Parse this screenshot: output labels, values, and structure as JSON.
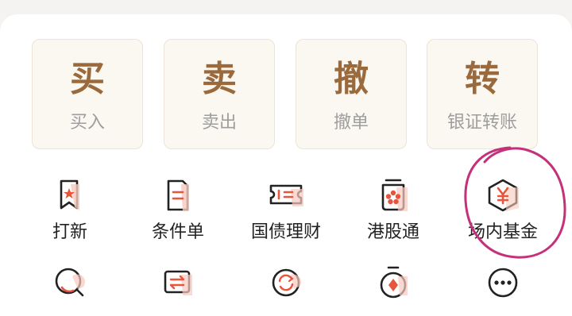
{
  "trade_tiles": [
    {
      "glyph": "买",
      "label": "买入"
    },
    {
      "glyph": "卖",
      "label": "卖出"
    },
    {
      "glyph": "撤",
      "label": "撤单"
    },
    {
      "glyph": "转",
      "label": "银证转账"
    }
  ],
  "feature_row_1": [
    {
      "label": "打新",
      "icon": "bookmark-star-icon"
    },
    {
      "label": "条件单",
      "icon": "conditional-order-icon"
    },
    {
      "label": "国债理财",
      "icon": "bond-ticket-icon"
    },
    {
      "label": "港股通",
      "icon": "hk-stock-connect-icon"
    },
    {
      "label": "场内基金",
      "icon": "yen-hexagon-icon"
    }
  ],
  "feature_row_2": [
    {
      "icon": "search-icon"
    },
    {
      "icon": "transfer-icon"
    },
    {
      "icon": "refresh-icon"
    },
    {
      "icon": "medal-icon"
    },
    {
      "icon": "more-icon"
    }
  ],
  "colors": {
    "accent": "#e8553c",
    "tile_text": "#9a6a3d",
    "tile_bg": "#fbf7f1",
    "highlight_circle": "#c4307a"
  }
}
